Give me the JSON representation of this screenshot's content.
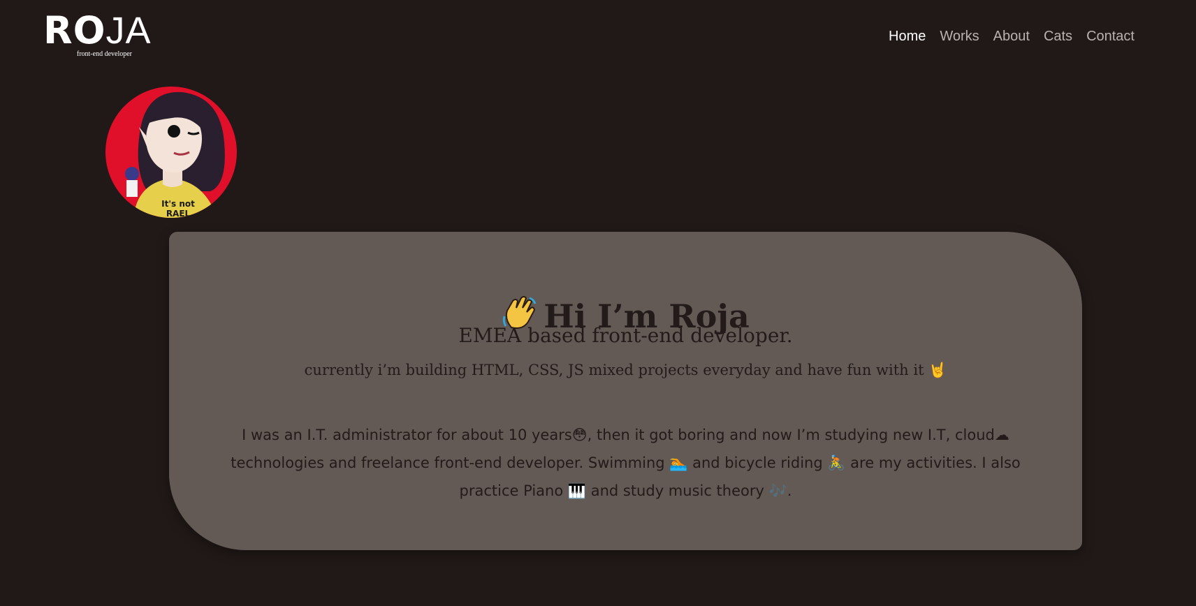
{
  "brand": {
    "logo_text_bold": "RO",
    "logo_text_thin": "JA",
    "tagline": "front-end developer"
  },
  "nav": {
    "items": [
      {
        "label": "Home",
        "active": true
      },
      {
        "label": "Works",
        "active": false
      },
      {
        "label": "About",
        "active": false
      },
      {
        "label": "Cats",
        "active": false
      },
      {
        "label": "Contact",
        "active": false
      }
    ]
  },
  "avatar": {
    "shirt_text": "It's not RAEL"
  },
  "hero": {
    "greeting": "Hi I’m Roja",
    "subtitle": "EMEA based front-end developer.",
    "current": "currently i’m building HTML, CSS, JS mixed projects everyday and have fun with it 🤘",
    "bio": "I was an I.T. administrator for about 10 years😳, then it got boring and now I’m studying new I.T, cloud☁ technologies and freelance front-end developer. Swimming 🏊 and bicycle riding 🚴 are my activities. I also practice Piano 🎹 and study music theory 🎶."
  },
  "colors": {
    "background": "#211918",
    "card": "#635a56",
    "text_dark": "#231b1a",
    "nav_inactive": "#b9b2b0",
    "nav_active": "#ffffff",
    "avatar_bg": "#e0102a"
  }
}
